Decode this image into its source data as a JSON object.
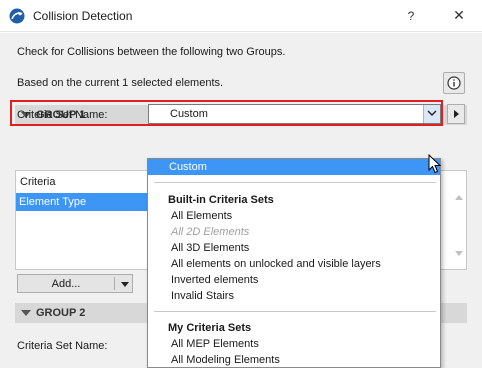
{
  "window": {
    "title": "Collision Detection",
    "help": "?",
    "close": "✕"
  },
  "description": {
    "line1": "Check for Collisions between the following two Groups.",
    "line2": "Based on the current 1 selected elements."
  },
  "group1": {
    "header": "GROUP 1",
    "criteria_label": "Criteria Set Name:",
    "criteria_value": "Custom",
    "list_header": "Criteria",
    "list_selected": "Element Type",
    "add_label": "Add..."
  },
  "group2": {
    "header": "GROUP 2",
    "criteria_label": "Criteria Set Name:"
  },
  "dropdown": {
    "selected": "Custom",
    "builtin_heading": "Built-in Criteria Sets",
    "builtin_items": [
      "All Elements",
      "All 2D Elements",
      "All 3D Elements",
      "All elements on unlocked and visible layers",
      "Inverted elements",
      "Invalid Stairs"
    ],
    "my_heading": "My Criteria Sets",
    "my_items": [
      "All MEP Elements",
      "All Modeling Elements"
    ]
  },
  "colors": {
    "accent": "#3d95f5",
    "highlight_border": "#e02020"
  },
  "icons": {
    "app": "archicad-icon",
    "info": "info-icon",
    "close": "close-icon",
    "help": "help-icon"
  }
}
